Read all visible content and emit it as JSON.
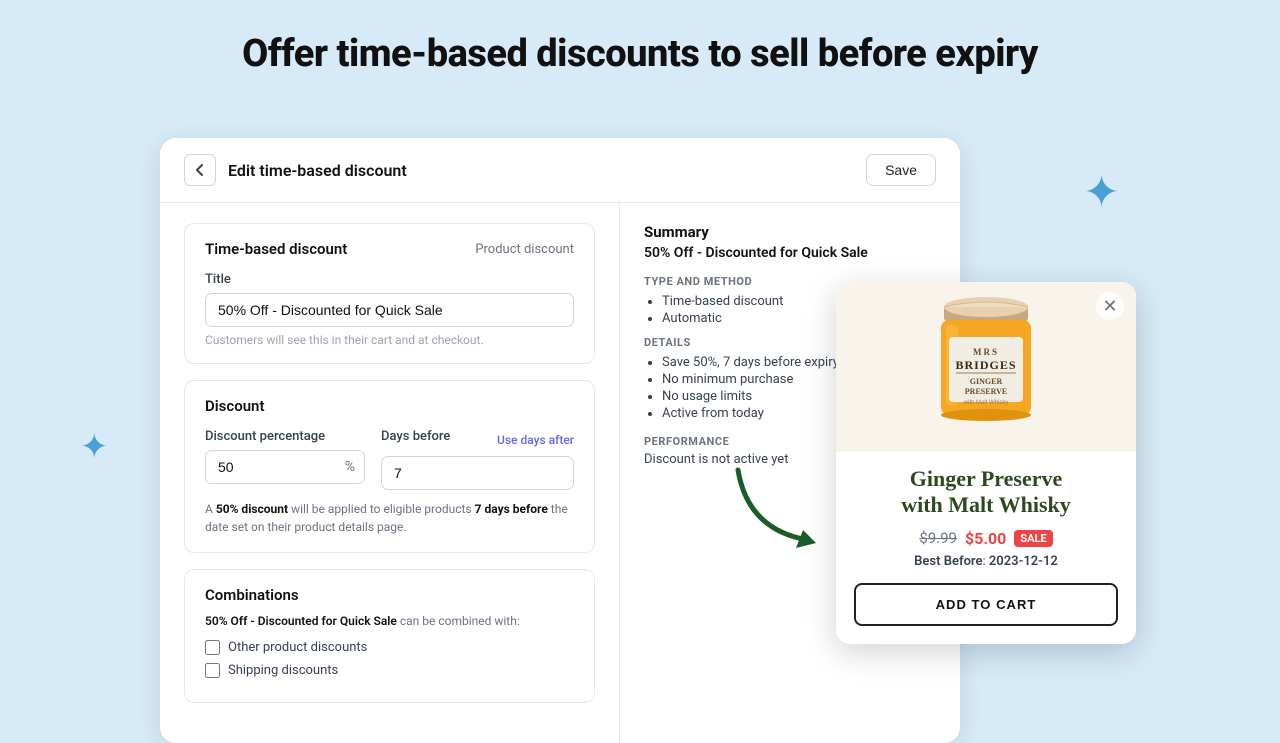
{
  "page": {
    "headline": "Offer time-based discounts to sell before expiry"
  },
  "header": {
    "title": "Edit time-based discount",
    "save_label": "Save"
  },
  "left_col": {
    "section1": {
      "title": "Time-based discount",
      "badge": "Product discount",
      "title_field_label": "Title",
      "title_field_value": "50% Off - Discounted for Quick Sale",
      "title_helper": "Customers will see this in their cart and at checkout."
    },
    "section2": {
      "title": "Discount",
      "pct_label": "Discount percentage",
      "pct_value": "50",
      "pct_suffix": "%",
      "days_label": "Days before",
      "days_value": "7",
      "use_days_after_label": "Use days after",
      "info": "A <strong>50% discount</strong> will be applied to eligible products <strong>7 days before</strong> the date set on their product details page."
    },
    "section3": {
      "title": "Combinations",
      "combo_desc": "<strong>50% Off - Discounted for Quick Sale</strong> can be combined with:",
      "checkbox1_label": "Other product discounts",
      "checkbox2_label": "Shipping discounts"
    }
  },
  "right_col": {
    "summary_title": "Summary",
    "summary_subtitle": "50% Off - Discounted for Quick Sale",
    "type_method_label": "TYPE AND METHOD",
    "type_items": [
      "Time-based discount",
      "Automatic"
    ],
    "details_label": "DETAILS",
    "details_items": [
      "Save 50%, 7 days before expiry",
      "No minimum purchase",
      "No usage limits",
      "Active from today"
    ],
    "performance_label": "Performance",
    "performance_text": "Discount is not active yet"
  },
  "popup": {
    "product_name": "Ginger Preserve\nwith Malt Whisky",
    "price_original": "$9.99",
    "price_sale": "$5.00",
    "sale_badge": "SALE",
    "best_before_label": "Best Before",
    "best_before_date": "2023-12-12",
    "add_to_cart_label": "ADD TO CART"
  },
  "stars": {
    "top_right": "✦",
    "left_mid": "✦"
  }
}
